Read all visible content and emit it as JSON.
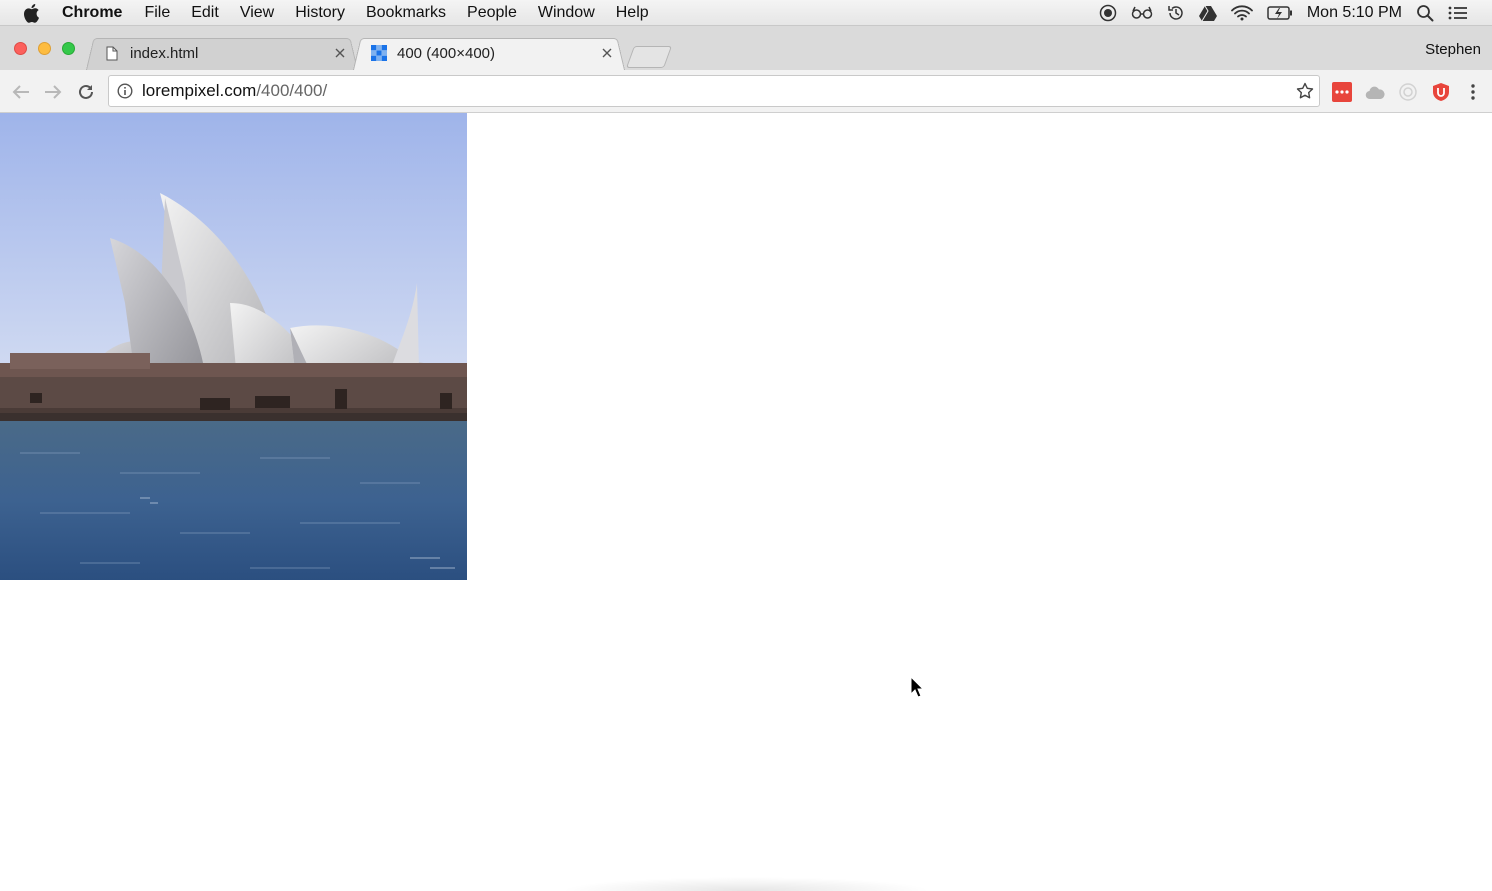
{
  "menubar": {
    "items": [
      "Chrome",
      "File",
      "Edit",
      "View",
      "History",
      "Bookmarks",
      "People",
      "Window",
      "Help"
    ],
    "clock": "Mon 5:10 PM"
  },
  "tabs": [
    {
      "title": "index.html",
      "favicon": "document-icon",
      "active": false
    },
    {
      "title": "400 (400×400)",
      "favicon": "lorempixel-icon",
      "active": true
    }
  ],
  "profile_name": "Stephen",
  "address_bar": {
    "host": "lorempixel.com",
    "path": "/400/400/"
  },
  "colors": {
    "close": "#fc605c",
    "minimize": "#fdbc40",
    "maximize": "#34c84a",
    "favicon_blue": "#1a73e8",
    "ext_red": "#e8453c"
  }
}
